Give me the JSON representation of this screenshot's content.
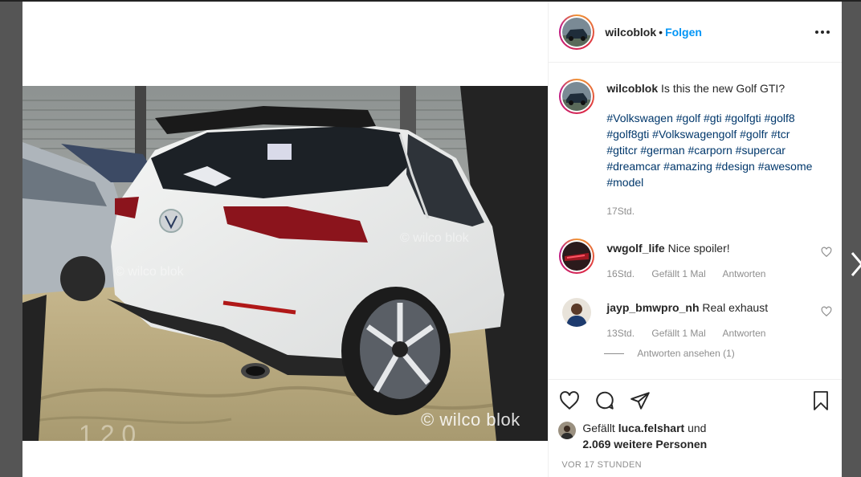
{
  "post": {
    "username": "wilcoblok",
    "separator": "•",
    "follow_label": "Folgen",
    "watermark": "© wilco blok",
    "watermark_faint_1": "© wilco blok",
    "watermark_faint_2": "© wilco blok",
    "caption": {
      "username": "wilcoblok",
      "text": "Is this the new Golf GTI?",
      "hashtags": "#Volkswagen #golf #gti #golfgti #golf8 #golf8gti #Volkswagengolf #golfr #tcr #gtitcr #german #carporn #supercar #dreamcar #amazing #design #awesome #model",
      "time": "17Std."
    },
    "comments": [
      {
        "username": "vwgolf_life",
        "text": "Nice spoiler!",
        "time": "16Std.",
        "likes": "Gefällt 1 Mal",
        "reply": "Antworten"
      },
      {
        "username": "jayp_bmwpro_nh",
        "text": "Real exhaust",
        "time": "13Std.",
        "likes": "Gefällt 1 Mal",
        "reply": "Antworten",
        "view_replies": "Antworten ansehen (1)"
      }
    ],
    "likes": {
      "prefix": "Gefällt",
      "user": "luca.felshart",
      "conjunction": "und",
      "others": "2.069 weitere Personen"
    },
    "timestamp": "VOR 17 STUNDEN"
  },
  "icons": {
    "like": "heart-icon",
    "comment": "comment-icon",
    "share": "paper-plane-icon",
    "save": "bookmark-icon",
    "more": "more-options-icon",
    "next": "chevron-right-icon"
  },
  "colors": {
    "follow": "#0095f6",
    "hashtag": "#00376b",
    "muted": "#8e8e8e",
    "text": "#262626"
  }
}
